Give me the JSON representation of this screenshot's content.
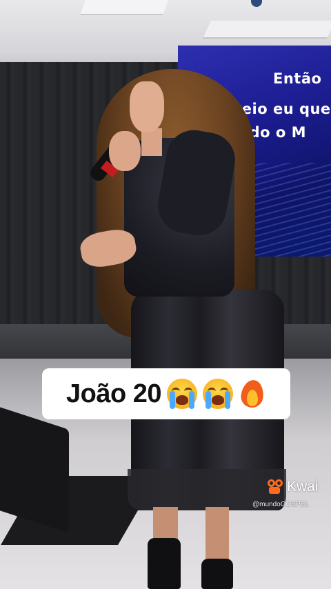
{
  "video": {
    "screen_lyrics": [
      "Então",
      "Creio eu que",
      "uando o M"
    ],
    "caption": {
      "text": "João 20",
      "emojis": [
        "loudly-crying-face",
        "loudly-crying-face",
        "fire"
      ]
    },
    "watermark": {
      "brand": "Kwai",
      "handle": "@mundoGOSPEL",
      "brand_color": "#ff6a1f"
    }
  }
}
